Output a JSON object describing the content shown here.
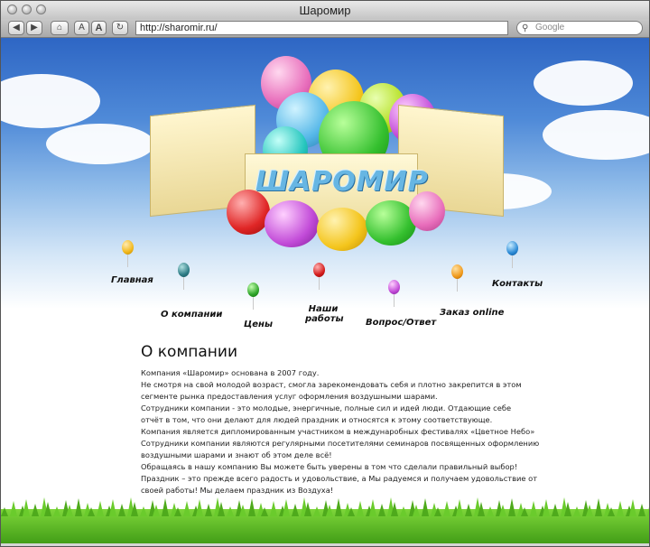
{
  "window": {
    "title": "Шаромир"
  },
  "toolbar": {
    "back_icon": "back-arrow-icon",
    "forward_icon": "forward-arrow-icon",
    "home_icon": "home-icon",
    "font_small_label": "A",
    "font_large_label": "A",
    "reload_icon": "reload-icon",
    "url": "http://sharomir.ru/",
    "search_placeholder": "Google"
  },
  "site": {
    "logo_text": "ШАРОМИР",
    "nav": [
      {
        "label": "Главная"
      },
      {
        "label": "О компании"
      },
      {
        "label": "Цены"
      },
      {
        "label": "Наши работы"
      },
      {
        "label": "Вопрос/Ответ"
      },
      {
        "label": "Заказ online"
      },
      {
        "label": "Контакты"
      }
    ],
    "heading": "О компании",
    "paragraph_lines": [
      "Компания «Шаромир» основана в 2007 году.",
      "Не смотря на свой молодой возраст, смогла зарекомендовать себя и плотно закрепится в этом",
      "сегменте рынка предоставления услуг оформления воздушными шарами.",
      "Сотрудники компании - это молодые, энергичные, полные сил и идей люди. Отдающие себе",
      "отчёт в том, что они делают для людей праздник и относятся к этому соответствующе.",
      "Компания является дипломированным участником в междунаробных фестивалях «Цветное Небо»",
      "Сотрудники компании являются регулярными посетителями семинаров посвященных оформлению",
      "воздушными шарами и знают об этом деле всё!",
      "Обращаясь в нашу компанию Вы можете быть уверены в том что сделали правильный выбор!",
      "Праздник – это прежде всего радость и удовольствие, а Мы радуемся и получаем удовольствие от",
      "своей работы! Мы делаем праздник из Воздуха!"
    ]
  },
  "colors": {
    "sky_top": "#2e66c4",
    "grass": "#5fbd25",
    "logo": "#67b6e3"
  }
}
